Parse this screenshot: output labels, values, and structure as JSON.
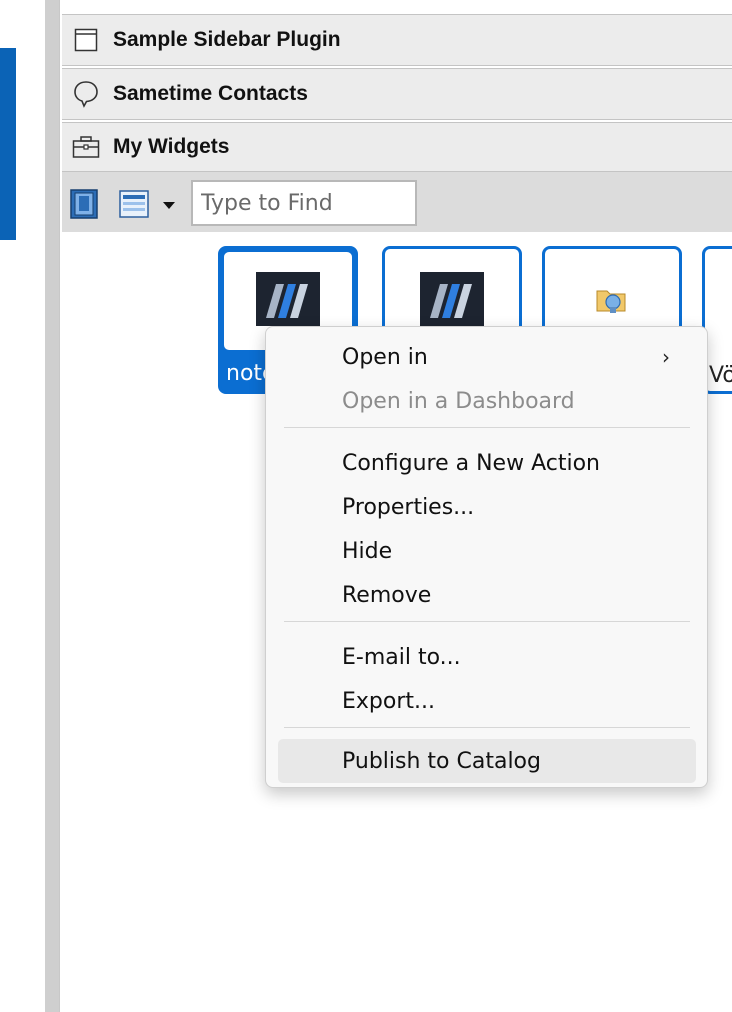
{
  "sidebar_sections": [
    {
      "title": "Sample Sidebar Plugin",
      "icon": "window-icon"
    },
    {
      "title": "Sametime Contacts",
      "icon": "chat-bubble-icon"
    },
    {
      "title": "My Widgets",
      "icon": "briefcase-icon"
    }
  ],
  "toolbar": {
    "search_placeholder": "Type to Find",
    "search_value": ""
  },
  "widgets": [
    {
      "label": "note",
      "icon": "notes-app-icon",
      "selected": true
    },
    {
      "label": "",
      "icon": "notes-app-icon",
      "selected": false
    },
    {
      "label": "",
      "icon": "plugin-folder-icon",
      "selected": false
    },
    {
      "label": "Vö",
      "icon": "",
      "selected": false
    }
  ],
  "context_menu": {
    "groups": [
      [
        {
          "label": "Open in",
          "submenu": true,
          "enabled": true
        },
        {
          "label": "Open in a Dashboard",
          "enabled": false
        }
      ],
      [
        {
          "label": "Configure a New Action",
          "enabled": true
        },
        {
          "label": "Properties...",
          "enabled": true
        },
        {
          "label": "Hide",
          "enabled": true
        },
        {
          "label": "Remove",
          "enabled": true
        }
      ],
      [
        {
          "label": "E-mail to...",
          "enabled": true
        },
        {
          "label": "Export...",
          "enabled": true
        }
      ],
      [
        {
          "label": "Publish to Catalog",
          "enabled": true,
          "highlighted": true
        }
      ]
    ],
    "submenu_arrow": "›"
  },
  "colors": {
    "accent": "#0b6ed2",
    "left_accent": "#0b63b6",
    "header_bg": "#ececec",
    "toolbar_bg": "#dcdcdc"
  }
}
